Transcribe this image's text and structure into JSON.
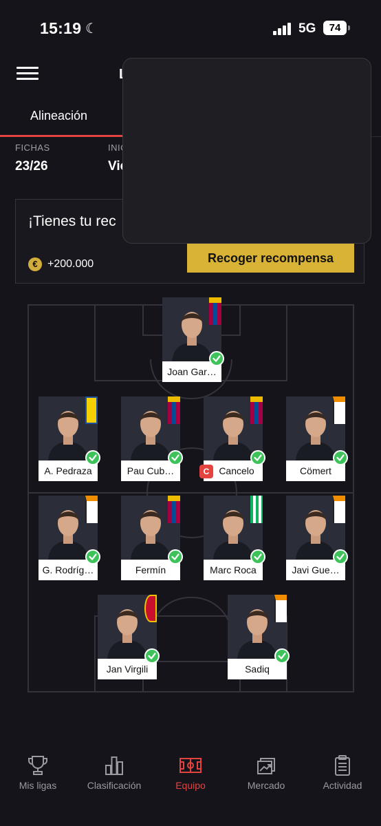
{
  "status_bar": {
    "time": "15:19",
    "network": "5G",
    "battery": "74"
  },
  "header": {
    "title_fragment": "L"
  },
  "tabs": {
    "active_label": "Alineación"
  },
  "stats": {
    "fichas_label": "FICHAS",
    "fichas_value": "23/26",
    "inicio_label": "INIC",
    "inicio_value": "Vie"
  },
  "reward": {
    "title": "¡Tienes tu rec",
    "amount": "+200.000",
    "coin_symbol": "€",
    "button_label": "Recoger recompensa"
  },
  "colors": {
    "background": "#15141b",
    "accent": "#e4443f",
    "reward_button": "#d9b335",
    "check": "#3ec25a"
  },
  "lineup": {
    "goalkeeper": [
      {
        "name": "Joan Gar…",
        "club": "barcelona",
        "captain": false
      }
    ],
    "defenders": [
      {
        "name": "A. Pedraza",
        "club": "villarreal",
        "captain": false
      },
      {
        "name": "Pau Cub…",
        "club": "barcelona",
        "captain": false
      },
      {
        "name": "Cancelo",
        "club": "barcelona",
        "captain": true,
        "captain_badge": "C"
      },
      {
        "name": "Cömert",
        "club": "valencia",
        "captain": false
      }
    ],
    "midfielders": [
      {
        "name": "G. Rodríg…",
        "club": "valencia",
        "captain": false
      },
      {
        "name": "Fermín",
        "club": "barcelona",
        "captain": false
      },
      {
        "name": "Marc Roca",
        "club": "betis",
        "captain": false
      },
      {
        "name": "Javi Gue…",
        "club": "valencia",
        "captain": false
      }
    ],
    "forwards": [
      {
        "name": "Jan Virgili",
        "club": "mallorca",
        "captain": false
      },
      {
        "name": "Sadiq",
        "club": "valencia",
        "captain": false
      }
    ]
  },
  "bottom_nav": {
    "items": [
      {
        "label": "Mis ligas",
        "icon": "trophy-icon"
      },
      {
        "label": "Clasificación",
        "icon": "bar-chart-icon"
      },
      {
        "label": "Equipo",
        "icon": "pitch-icon",
        "active": true
      },
      {
        "label": "Mercado",
        "icon": "market-icon"
      },
      {
        "label": "Actividad",
        "icon": "clipboard-icon"
      }
    ]
  }
}
